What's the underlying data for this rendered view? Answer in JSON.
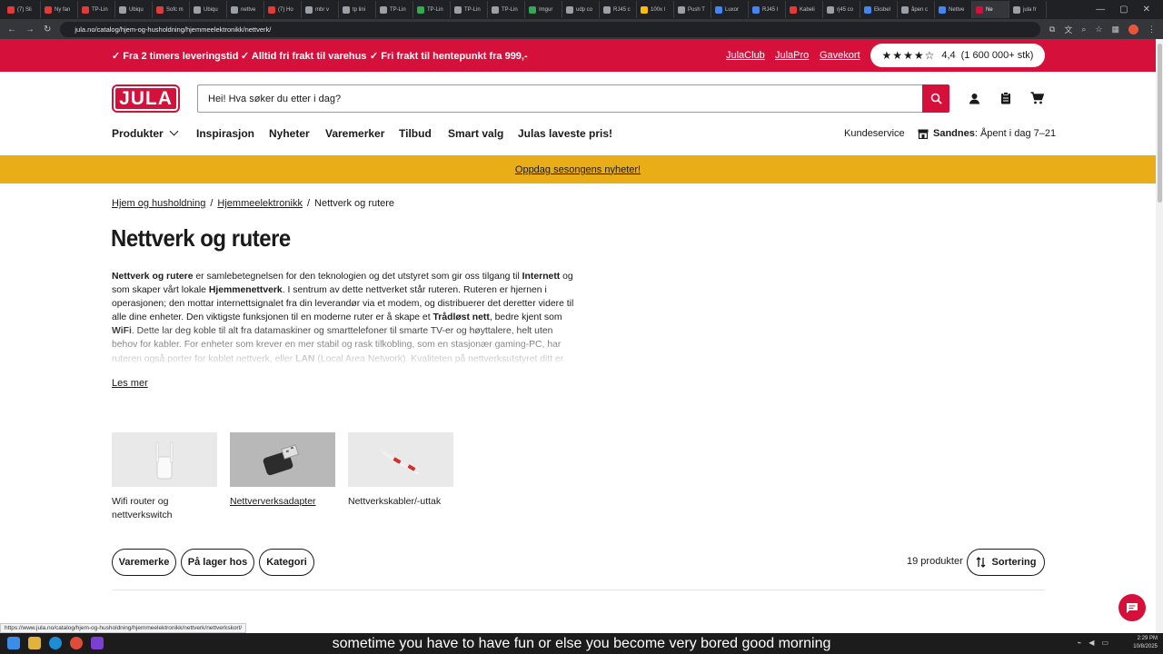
{
  "browser": {
    "tabs": [
      {
        "label": "(7) Sli",
        "color": "#e53935"
      },
      {
        "label": "Ny fan",
        "color": "#e53935"
      },
      {
        "label": "TP-Lin",
        "color": "#e53935"
      },
      {
        "label": "Ubiqu",
        "color": "#9aa0a6"
      },
      {
        "label": "Sofc m",
        "color": "#e53935"
      },
      {
        "label": "Ubiqu",
        "color": "#9aa0a6"
      },
      {
        "label": "nettve",
        "color": "#9aa0a6"
      },
      {
        "label": "(7) Ho",
        "color": "#e53935"
      },
      {
        "label": "mbr v",
        "color": "#9aa0a6"
      },
      {
        "label": "tp lini",
        "color": "#9aa0a6"
      },
      {
        "label": "TP-Lin",
        "color": "#9aa0a6"
      },
      {
        "label": "TP-Lin",
        "color": "#34a853"
      },
      {
        "label": "TP-Lin",
        "color": "#9aa0a6"
      },
      {
        "label": "TP-Lin",
        "color": "#9aa0a6"
      },
      {
        "label": "Imgur",
        "color": "#34a853"
      },
      {
        "label": "udp co",
        "color": "#9aa0a6"
      },
      {
        "label": "RJ45 c",
        "color": "#9aa0a6"
      },
      {
        "label": "100x l",
        "color": "#fbbc04"
      },
      {
        "label": "Push T",
        "color": "#9aa0a6"
      },
      {
        "label": "Luxor",
        "color": "#4285f4"
      },
      {
        "label": "RJ45 I",
        "color": "#4285f4"
      },
      {
        "label": "Kabeli",
        "color": "#e53935"
      },
      {
        "label": "rj45 co",
        "color": "#9aa0a6"
      },
      {
        "label": "Eksbel",
        "color": "#4285f4"
      },
      {
        "label": "åpen c",
        "color": "#9aa0a6"
      },
      {
        "label": "Nettve",
        "color": "#4285f4"
      },
      {
        "label": "Ne",
        "color": "#d5103a",
        "active": true
      },
      {
        "label": "jula fr",
        "color": "#9aa0a6"
      }
    ],
    "url": "jula.no/catalog/hjem-og-husholdning/hjemmeelektronikk/nettverk/",
    "status_url": "https://www.jula.no/catalog/hjem-og-husholdning/hjemmeelektronikk/nettverk/nettverkskort/"
  },
  "promo": {
    "item1": "Fra 2 timers leveringstid",
    "item2": "Alltid fri frakt til varehus",
    "item3": "Fri frakt til hentepunkt fra 999,-",
    "link1": "JulaClub",
    "link2": "JulaPro",
    "link3": "Gavekort",
    "rating": "4,4",
    "rating_count": "(1 600 000+ stk)"
  },
  "header": {
    "logo_text": "JULA",
    "search_placeholder": "Hei! Hva søker du etter i dag?"
  },
  "nav": {
    "items": [
      "Produkter",
      "Inspirasjon",
      "Nyheter",
      "Varemerker",
      "Tilbud",
      "Smart valg",
      "Julas laveste pris!"
    ],
    "kundeservice": "Kundeservice",
    "store_name": "Sandnes",
    "store_hours": ": Åpent i dag 7–21"
  },
  "banner": {
    "text": "Oppdag sesongens nyheter!"
  },
  "breadcrumb": [
    "Hjem og husholdning",
    "Hjemmeelektronikk",
    "Nettverk og rutere"
  ],
  "breadcrumb_sep": "/",
  "page_title": "Nettverk og rutere",
  "description": {
    "parts": [
      {
        "t": "Nettverk og rutere",
        "b": true
      },
      {
        "t": " er samlebetegnelsen for den teknologien og det utstyret som gir oss tilgang til "
      },
      {
        "t": "Internett",
        "b": true
      },
      {
        "t": " og som skaper vårt lokale "
      },
      {
        "t": "Hjemmenettverk",
        "b": true
      },
      {
        "t": ". I sentrum av dette nettverket står ruteren. Ruteren er hjernen i operasjonen; den mottar internettsignalet fra din leverandør via et modem, og distribuerer det deretter videre til alle dine enheter. Den viktigste funksjonen til en moderne ruter er å skape et "
      },
      {
        "t": "Trådløst nett",
        "b": true
      },
      {
        "t": ", bedre kjent som "
      },
      {
        "t": "WiFi",
        "b": true
      },
      {
        "t": ". Dette lar deg koble til alt fra datamaskiner og smarttelefoner til smarte TV-er og høyttalere, helt uten behov for kabler. For enheter som krever en mer stabil og rask tilkobling, som en stasjonær gaming-PC, har ruteren også porter for kablet nettverk, eller "
      },
      {
        "t": "LAN",
        "b": true
      },
      {
        "t": " (Local Area Network). Kvaliteten på nettverksutstyret ditt er helt avgjørende for"
      }
    ],
    "read_more": "Les mer"
  },
  "categories": [
    {
      "label": "Wifi router og nettverkswitch",
      "icon": "router-icon",
      "underline": false,
      "bg": "#e9e9e9"
    },
    {
      "label": "Nettververksadapter",
      "icon": "usb-adapter-icon",
      "underline": true,
      "bg": "#b8b8b8"
    },
    {
      "label": "Nettverkskabler/-uttak",
      "icon": "cable-icon",
      "underline": false,
      "bg": "#e9e9e9"
    }
  ],
  "filters": [
    "Varemerke",
    "På lager hos",
    "Kategori"
  ],
  "product_count": "19 produkter",
  "sort_label": "Sortering",
  "caption": "sometime you have to have fun or else you become very bored good morning",
  "taskbar": {
    "time": "2:29 PM",
    "date": "10/8/2025"
  }
}
